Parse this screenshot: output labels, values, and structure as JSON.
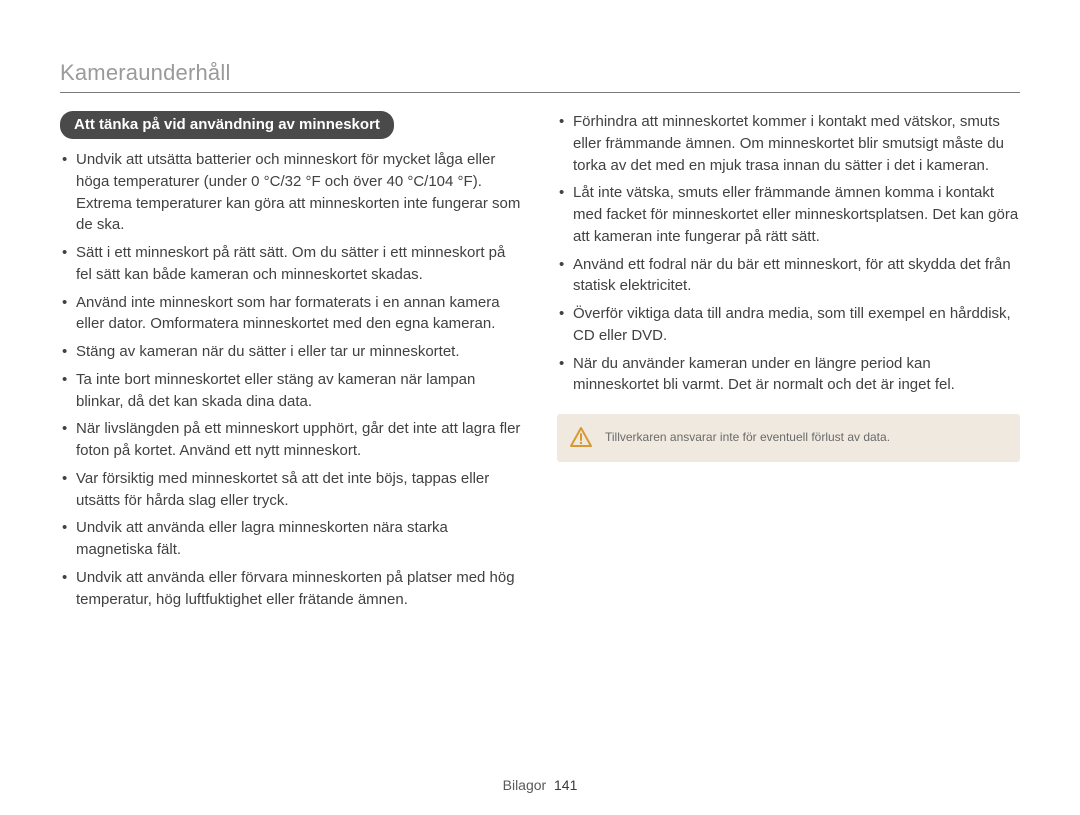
{
  "header": {
    "title": "Kameraunderhåll"
  },
  "pill_label": "Att tänka på vid användning av minneskort",
  "left_items": [
    "Undvik att utsätta batterier och minneskort för mycket låga eller höga temperaturer (under 0 °C/32 °F och över 40 °C/104 °F). Extrema temperaturer kan göra att minneskorten inte fungerar som de ska.",
    "Sätt i ett minneskort på rätt sätt. Om du sätter i ett minneskort på fel sätt kan både kameran och minneskortet skadas.",
    "Använd inte minneskort som har formaterats i en annan kamera eller dator. Omformatera minneskortet med den egna kameran.",
    "Stäng av kameran när du sätter i eller tar ur minneskortet.",
    "Ta inte bort minneskortet eller stäng av kameran när lampan blinkar, då det kan skada dina data.",
    "När livslängden på ett minneskort upphört, går det inte att lagra fler foton på kortet. Använd ett nytt minneskort.",
    "Var försiktig med minneskortet så att det inte böjs, tappas eller utsätts för hårda slag eller tryck.",
    "Undvik att använda eller lagra minneskorten nära starka magnetiska fält.",
    "Undvik att använda eller förvara minneskorten på platser med hög temperatur, hög luftfuktighet eller frätande ämnen."
  ],
  "right_items": [
    "Förhindra att minneskortet kommer i kontakt med vätskor, smuts eller främmande ämnen. Om minneskortet blir smutsigt måste du torka av det med en mjuk trasa innan du sätter i det i kameran.",
    "Låt inte vätska, smuts eller främmande ämnen komma i kontakt med facket för minneskortet eller minneskortsplatsen. Det kan göra att kameran inte fungerar på rätt sätt.",
    "Använd ett fodral när du bär ett minneskort, för att skydda det från statisk elektricitet.",
    "Överför viktiga data till andra media, som till exempel en hårddisk, CD eller DVD.",
    "När du använder kameran under en längre period kan minneskortet bli varmt. Det är normalt och det är inget fel."
  ],
  "note": {
    "text": "Tillverkaren ansvarar inte för eventuell förlust av data."
  },
  "footer": {
    "section": "Bilagor",
    "page_number": "141"
  }
}
